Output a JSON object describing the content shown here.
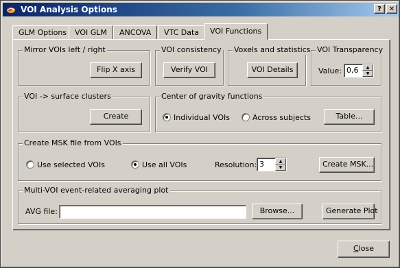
{
  "window": {
    "title": "VOI Analysis Options",
    "help_label": "?",
    "close_label": "✕"
  },
  "tabs": [
    {
      "label": "GLM Options"
    },
    {
      "label": "VOI GLM"
    },
    {
      "label": "ANCOVA"
    },
    {
      "label": "VTC Data"
    },
    {
      "label": "VOI Functions",
      "active": true
    }
  ],
  "mirror": {
    "title": "Mirror VOIs left / right",
    "button": "Flip X axis"
  },
  "consistency": {
    "title": "VOI consistency",
    "button": "Verify VOI"
  },
  "voxels": {
    "title": "Voxels and statistics",
    "button": "VOI Details"
  },
  "transparency": {
    "title": "VOI Transparency",
    "value_label": "Value:",
    "value": "0,6"
  },
  "surface": {
    "title": "VOI -> surface clusters",
    "button": "Create"
  },
  "gravity": {
    "title": "Center of gravity functions",
    "options": [
      {
        "label": "Individual VOIs",
        "selected": true
      },
      {
        "label": "Across subjects",
        "selected": false
      }
    ],
    "button": "Table..."
  },
  "msk": {
    "title": "Create MSK file from VOIs",
    "options": [
      {
        "label": "Use selected VOIs",
        "selected": false
      },
      {
        "label": "Use all VOIs",
        "selected": true
      }
    ],
    "resolution_label": "Resolution:",
    "resolution_value": "3",
    "button": "Create MSK..."
  },
  "avg": {
    "title": "Multi-VOI event-related averaging plot",
    "file_label": "AVG file:",
    "file_value": "",
    "browse_button": "Browse...",
    "generate_button": "Generate Plot"
  },
  "footer": {
    "close_first": "C",
    "close_rest": "lose"
  }
}
